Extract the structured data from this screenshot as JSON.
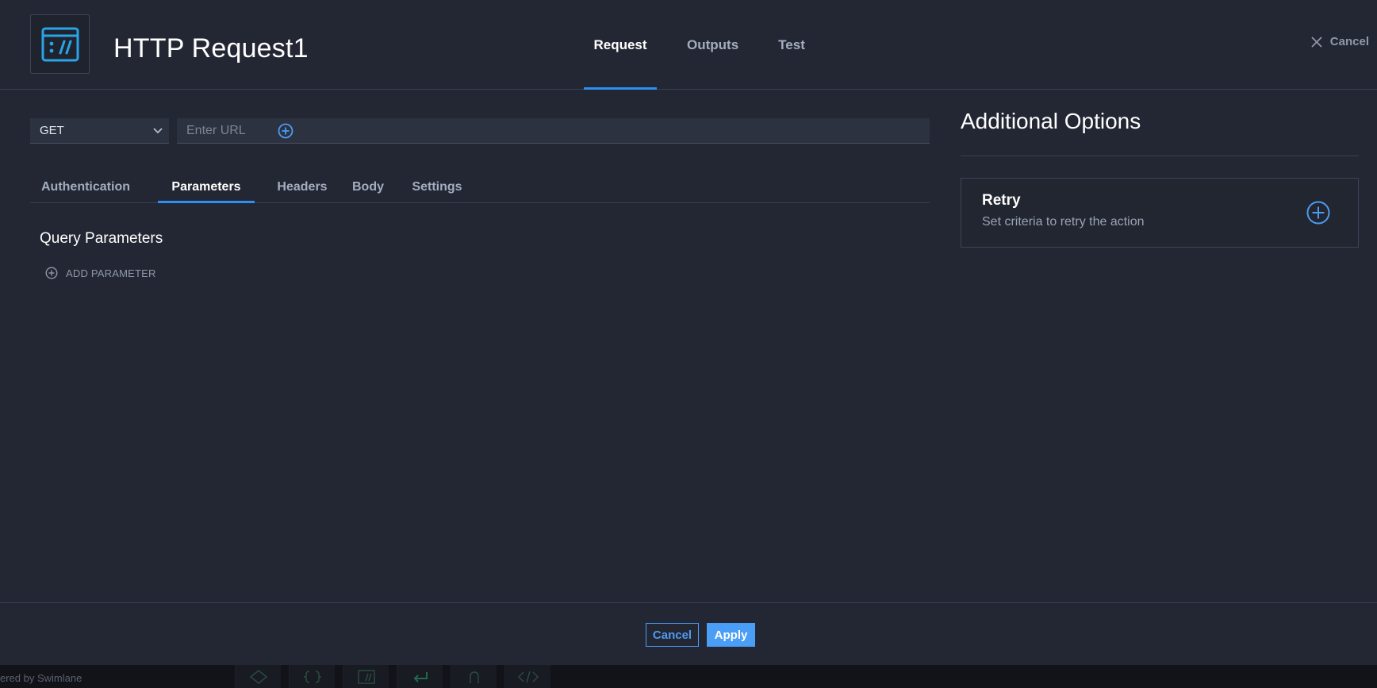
{
  "header": {
    "title": "HTTP Request1",
    "logo_icon": "http-request-icon",
    "tabs": [
      {
        "label": "Request",
        "active": true
      },
      {
        "label": "Outputs",
        "active": false
      },
      {
        "label": "Test",
        "active": false
      }
    ],
    "cancel_label": "Cancel"
  },
  "request": {
    "method": "GET",
    "url_placeholder": "Enter URL",
    "url_value": "",
    "subtabs": [
      {
        "label": "Authentication",
        "active": false
      },
      {
        "label": "Parameters",
        "active": true
      },
      {
        "label": "Headers",
        "active": false
      },
      {
        "label": "Body",
        "active": false
      },
      {
        "label": "Settings",
        "active": false
      }
    ],
    "section_title": "Query Parameters",
    "add_parameter_label": "ADD PARAMETER"
  },
  "options": {
    "title": "Additional Options",
    "retry": {
      "title": "Retry",
      "description": "Set criteria to retry the action"
    }
  },
  "footer": {
    "cancel_label": "Cancel",
    "apply_label": "Apply"
  },
  "bottom_bar": {
    "powered_text": "ered by Swimlane",
    "icons": [
      "ip-icon",
      "braces-icon",
      "http-icon",
      "return-icon",
      "branch-icon",
      "code-icon"
    ]
  },
  "colors": {
    "background": "#232733",
    "accent": "#2f8ef0",
    "apply_button": "#4b9ef5",
    "logo": "#2ba3e8"
  }
}
